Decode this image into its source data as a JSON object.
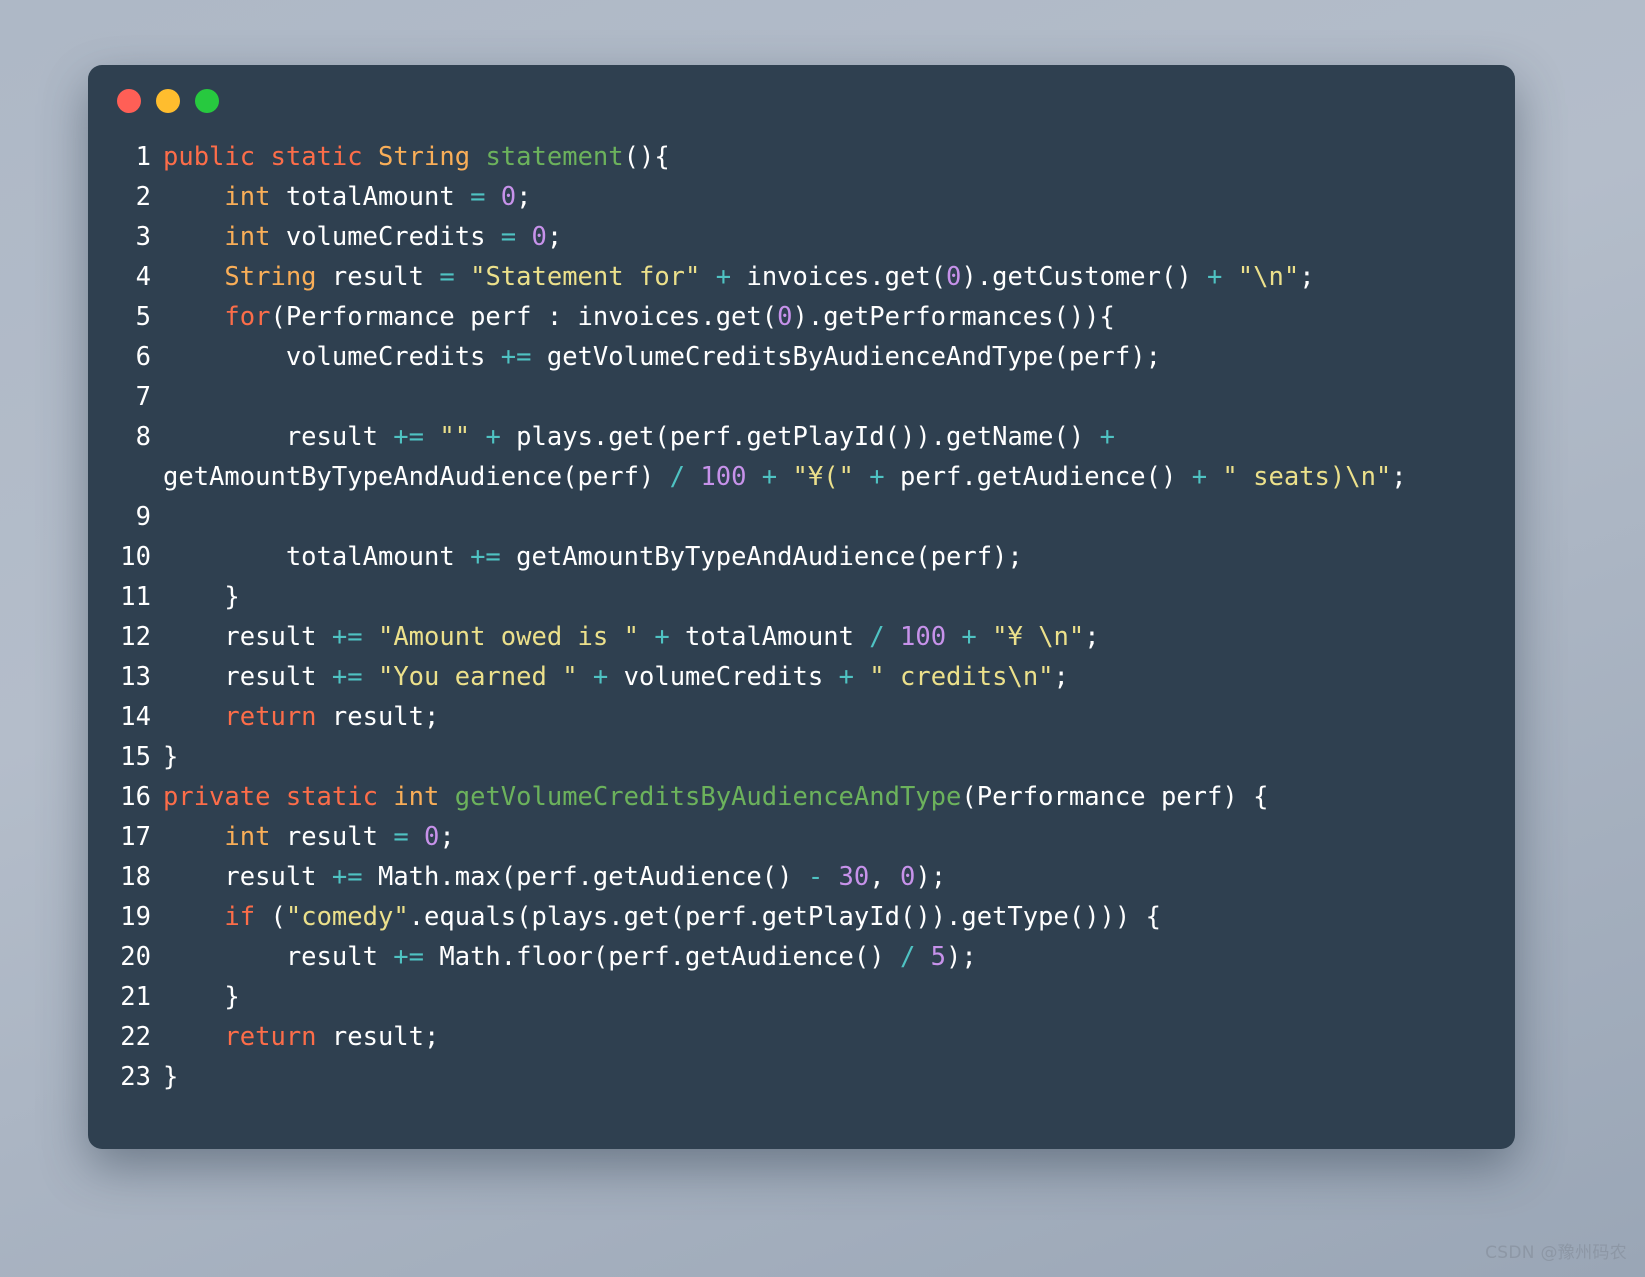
{
  "window": {
    "background_color": "#2f4050",
    "page_background_color": "#aeb8c6",
    "controls": [
      {
        "name": "close",
        "color": "#ff5f56"
      },
      {
        "name": "minimize",
        "color": "#ffbd2e"
      },
      {
        "name": "maximize",
        "color": "#27c93f"
      }
    ]
  },
  "editor": {
    "language": "java",
    "theme_colors": {
      "keyword": "#fc6d49",
      "type": "#f9ae58",
      "function": "#6cb25c",
      "string": "#ece08b",
      "number": "#c792ea",
      "operator": "#4fc3c3",
      "plain": "#ffffff",
      "background": "#2f4050"
    },
    "lines": [
      {
        "n": "1",
        "tokens": [
          {
            "t": "public",
            "c": "kw"
          },
          {
            "t": " ",
            "c": "pl"
          },
          {
            "t": "static",
            "c": "kw"
          },
          {
            "t": " ",
            "c": "pl"
          },
          {
            "t": "String",
            "c": "typ"
          },
          {
            "t": " ",
            "c": "pl"
          },
          {
            "t": "statement",
            "c": "fn"
          },
          {
            "t": "(){",
            "c": "pl"
          }
        ]
      },
      {
        "n": "2",
        "tokens": [
          {
            "t": "    ",
            "c": "pl"
          },
          {
            "t": "int",
            "c": "typ"
          },
          {
            "t": " totalAmount ",
            "c": "pl"
          },
          {
            "t": "=",
            "c": "op"
          },
          {
            "t": " ",
            "c": "pl"
          },
          {
            "t": "0",
            "c": "num"
          },
          {
            "t": ";",
            "c": "pl"
          }
        ]
      },
      {
        "n": "3",
        "tokens": [
          {
            "t": "    ",
            "c": "pl"
          },
          {
            "t": "int",
            "c": "typ"
          },
          {
            "t": " volumeCredits ",
            "c": "pl"
          },
          {
            "t": "=",
            "c": "op"
          },
          {
            "t": " ",
            "c": "pl"
          },
          {
            "t": "0",
            "c": "num"
          },
          {
            "t": ";",
            "c": "pl"
          }
        ]
      },
      {
        "n": "4",
        "tokens": [
          {
            "t": "    ",
            "c": "pl"
          },
          {
            "t": "String",
            "c": "typ"
          },
          {
            "t": " result ",
            "c": "pl"
          },
          {
            "t": "=",
            "c": "op"
          },
          {
            "t": " ",
            "c": "pl"
          },
          {
            "t": "\"Statement for\"",
            "c": "str"
          },
          {
            "t": " ",
            "c": "pl"
          },
          {
            "t": "+",
            "c": "op"
          },
          {
            "t": " invoices.get(",
            "c": "pl"
          },
          {
            "t": "0",
            "c": "num"
          },
          {
            "t": ").getCustomer() ",
            "c": "pl"
          },
          {
            "t": "+",
            "c": "op"
          },
          {
            "t": " ",
            "c": "pl"
          },
          {
            "t": "\"\\n\"",
            "c": "str"
          },
          {
            "t": ";",
            "c": "pl"
          }
        ]
      },
      {
        "n": "5",
        "tokens": [
          {
            "t": "    ",
            "c": "pl"
          },
          {
            "t": "for",
            "c": "kw"
          },
          {
            "t": "(Performance perf : invoices.get(",
            "c": "pl"
          },
          {
            "t": "0",
            "c": "num"
          },
          {
            "t": ").getPerformances()){",
            "c": "pl"
          }
        ]
      },
      {
        "n": "6",
        "tokens": [
          {
            "t": "        volumeCredits ",
            "c": "pl"
          },
          {
            "t": "+=",
            "c": "op"
          },
          {
            "t": " getVolumeCreditsByAudienceAndType(perf);",
            "c": "pl"
          }
        ]
      },
      {
        "n": "7",
        "tokens": [
          {
            "t": "",
            "c": "pl"
          }
        ]
      },
      {
        "n": "8",
        "tokens": [
          {
            "t": "        result ",
            "c": "pl"
          },
          {
            "t": "+=",
            "c": "op"
          },
          {
            "t": " ",
            "c": "pl"
          },
          {
            "t": "\"\"",
            "c": "str"
          },
          {
            "t": " ",
            "c": "pl"
          },
          {
            "t": "+",
            "c": "op"
          },
          {
            "t": " plays.get(perf.getPlayId()).getName() ",
            "c": "pl"
          },
          {
            "t": "+",
            "c": "op"
          },
          {
            "t": " getAmountByTypeAndAudience(perf) ",
            "c": "pl"
          },
          {
            "t": "/",
            "c": "op"
          },
          {
            "t": " ",
            "c": "pl"
          },
          {
            "t": "100",
            "c": "num"
          },
          {
            "t": " ",
            "c": "pl"
          },
          {
            "t": "+",
            "c": "op"
          },
          {
            "t": " ",
            "c": "pl"
          },
          {
            "t": "\"¥(\"",
            "c": "str"
          },
          {
            "t": " ",
            "c": "pl"
          },
          {
            "t": "+",
            "c": "op"
          },
          {
            "t": " perf.getAudience() ",
            "c": "pl"
          },
          {
            "t": "+",
            "c": "op"
          },
          {
            "t": " ",
            "c": "pl"
          },
          {
            "t": "\" seats)\\n\"",
            "c": "str"
          },
          {
            "t": ";",
            "c": "pl"
          }
        ]
      },
      {
        "n": "9",
        "tokens": [
          {
            "t": "",
            "c": "pl"
          }
        ]
      },
      {
        "n": "10",
        "tokens": [
          {
            "t": "        totalAmount ",
            "c": "pl"
          },
          {
            "t": "+=",
            "c": "op"
          },
          {
            "t": " getAmountByTypeAndAudience(perf);",
            "c": "pl"
          }
        ]
      },
      {
        "n": "11",
        "tokens": [
          {
            "t": "    }",
            "c": "pl"
          }
        ]
      },
      {
        "n": "12",
        "tokens": [
          {
            "t": "    result ",
            "c": "pl"
          },
          {
            "t": "+=",
            "c": "op"
          },
          {
            "t": " ",
            "c": "pl"
          },
          {
            "t": "\"Amount owed is \"",
            "c": "str"
          },
          {
            "t": " ",
            "c": "pl"
          },
          {
            "t": "+",
            "c": "op"
          },
          {
            "t": " totalAmount ",
            "c": "pl"
          },
          {
            "t": "/",
            "c": "op"
          },
          {
            "t": " ",
            "c": "pl"
          },
          {
            "t": "100",
            "c": "num"
          },
          {
            "t": " ",
            "c": "pl"
          },
          {
            "t": "+",
            "c": "op"
          },
          {
            "t": " ",
            "c": "pl"
          },
          {
            "t": "\"¥ \\n\"",
            "c": "str"
          },
          {
            "t": ";",
            "c": "pl"
          }
        ]
      },
      {
        "n": "13",
        "tokens": [
          {
            "t": "    result ",
            "c": "pl"
          },
          {
            "t": "+=",
            "c": "op"
          },
          {
            "t": " ",
            "c": "pl"
          },
          {
            "t": "\"You earned \"",
            "c": "str"
          },
          {
            "t": " ",
            "c": "pl"
          },
          {
            "t": "+",
            "c": "op"
          },
          {
            "t": " volumeCredits ",
            "c": "pl"
          },
          {
            "t": "+",
            "c": "op"
          },
          {
            "t": " ",
            "c": "pl"
          },
          {
            "t": "\" credits\\n\"",
            "c": "str"
          },
          {
            "t": ";",
            "c": "pl"
          }
        ]
      },
      {
        "n": "14",
        "tokens": [
          {
            "t": "    ",
            "c": "pl"
          },
          {
            "t": "return",
            "c": "kw"
          },
          {
            "t": " result;",
            "c": "pl"
          }
        ]
      },
      {
        "n": "15",
        "tokens": [
          {
            "t": "}",
            "c": "pl"
          }
        ]
      },
      {
        "n": "16",
        "tokens": [
          {
            "t": "private",
            "c": "kw"
          },
          {
            "t": " ",
            "c": "pl"
          },
          {
            "t": "static",
            "c": "kw"
          },
          {
            "t": " ",
            "c": "pl"
          },
          {
            "t": "int",
            "c": "typ"
          },
          {
            "t": " ",
            "c": "pl"
          },
          {
            "t": "getVolumeCreditsByAudienceAndType",
            "c": "fn"
          },
          {
            "t": "(Performance perf) {",
            "c": "pl"
          }
        ]
      },
      {
        "n": "17",
        "tokens": [
          {
            "t": "    ",
            "c": "pl"
          },
          {
            "t": "int",
            "c": "typ"
          },
          {
            "t": " result ",
            "c": "pl"
          },
          {
            "t": "=",
            "c": "op"
          },
          {
            "t": " ",
            "c": "pl"
          },
          {
            "t": "0",
            "c": "num"
          },
          {
            "t": ";",
            "c": "pl"
          }
        ]
      },
      {
        "n": "18",
        "tokens": [
          {
            "t": "    result ",
            "c": "pl"
          },
          {
            "t": "+=",
            "c": "op"
          },
          {
            "t": " Math.max(perf.getAudience() ",
            "c": "pl"
          },
          {
            "t": "-",
            "c": "op"
          },
          {
            "t": " ",
            "c": "pl"
          },
          {
            "t": "30",
            "c": "num"
          },
          {
            "t": ", ",
            "c": "pl"
          },
          {
            "t": "0",
            "c": "num"
          },
          {
            "t": ");",
            "c": "pl"
          }
        ]
      },
      {
        "n": "19",
        "tokens": [
          {
            "t": "    ",
            "c": "pl"
          },
          {
            "t": "if",
            "c": "kw"
          },
          {
            "t": " (",
            "c": "pl"
          },
          {
            "t": "\"comedy\"",
            "c": "str"
          },
          {
            "t": ".equals(plays.get(perf.getPlayId()).getType())) {",
            "c": "pl"
          }
        ]
      },
      {
        "n": "20",
        "tokens": [
          {
            "t": "        result ",
            "c": "pl"
          },
          {
            "t": "+=",
            "c": "op"
          },
          {
            "t": " Math.floor(perf.getAudience() ",
            "c": "pl"
          },
          {
            "t": "/",
            "c": "op"
          },
          {
            "t": " ",
            "c": "pl"
          },
          {
            "t": "5",
            "c": "num"
          },
          {
            "t": ");",
            "c": "pl"
          }
        ]
      },
      {
        "n": "21",
        "tokens": [
          {
            "t": "    }",
            "c": "pl"
          }
        ]
      },
      {
        "n": "22",
        "tokens": [
          {
            "t": "    ",
            "c": "pl"
          },
          {
            "t": "return",
            "c": "kw"
          },
          {
            "t": " result;",
            "c": "pl"
          }
        ]
      },
      {
        "n": "23",
        "tokens": [
          {
            "t": "}",
            "c": "pl"
          }
        ]
      }
    ]
  },
  "watermark": {
    "text": "CSDN @豫州码农"
  }
}
